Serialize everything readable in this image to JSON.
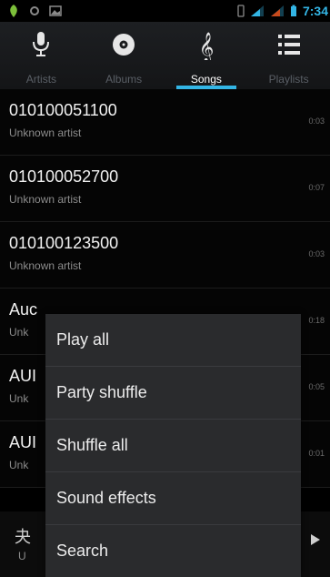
{
  "status_bar": {
    "time": "7:34"
  },
  "tabs": [
    {
      "label": "Artists",
      "icon": "microphone-icon"
    },
    {
      "label": "Albums",
      "icon": "disc-icon"
    },
    {
      "label": "Songs",
      "icon": "treble-clef-icon",
      "active": true
    },
    {
      "label": "Playlists",
      "icon": "list-icon"
    }
  ],
  "songs": [
    {
      "title": "010100051100",
      "artist": "Unknown artist",
      "duration": "0:03"
    },
    {
      "title": "010100052700",
      "artist": "Unknown artist",
      "duration": "0:07"
    },
    {
      "title": "010100123500",
      "artist": "Unknown artist",
      "duration": "0:03"
    },
    {
      "title": "Auc",
      "artist": "Unk",
      "duration": "0:18"
    },
    {
      "title": "AUI",
      "artist": "Unk",
      "duration": "0:05"
    },
    {
      "title": "AUI",
      "artist": "Unk",
      "duration": "0:01"
    }
  ],
  "now_playing": {
    "icon_glyph": "夬",
    "label": "U"
  },
  "menu": {
    "items": [
      "Play all",
      "Party shuffle",
      "Shuffle all",
      "Sound effects",
      "Search"
    ]
  },
  "colors": {
    "accent": "#33b5e5",
    "background": "#000000",
    "menu_bg": "#2a2b2d"
  }
}
